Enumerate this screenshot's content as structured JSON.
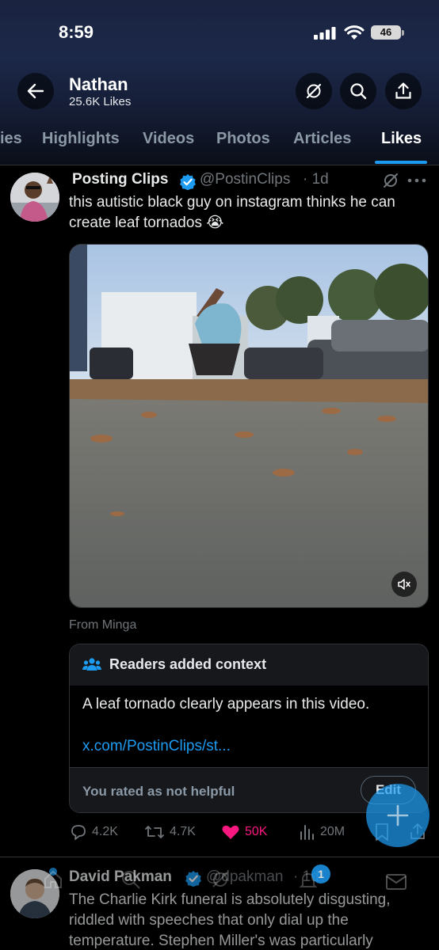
{
  "status_bar": {
    "time": "8:59",
    "battery": "46"
  },
  "profile": {
    "name": "Nathan",
    "likes": "25.6K Likes"
  },
  "tabs": [
    "ies",
    "Highlights",
    "Videos",
    "Photos",
    "Articles",
    "Likes"
  ],
  "active_tab": "Likes",
  "tweet1": {
    "name": "Posting Clips",
    "handle": "@PostinClips",
    "time": "· 1d",
    "text": "this autistic black guy on instagram thinks he can create leaf tornados 😭",
    "source": "From Minga",
    "note": {
      "title": "Readers added context",
      "body": "A leaf tornado clearly appears in this video.",
      "link": "x.com/PostinClips/st...",
      "rated": "You rated as not helpful",
      "edit": "Edit"
    },
    "actions": {
      "replies": "4.2K",
      "reposts": "4.7K",
      "likes": "50K",
      "views": "20M"
    }
  },
  "tweet2": {
    "name": "David Pakman",
    "handle": "@dpakman",
    "time": "· 1d",
    "text": "The Charlie Kirk funeral is absolutely disgusting, riddled with speeches that only dial up the temperature. Stephen Miller's was particularly"
  },
  "notification_badge": "1",
  "colors": {
    "accent": "#1d9bf0",
    "like": "#f91880",
    "background": "#000000"
  },
  "icons": [
    "back-arrow-icon",
    "grok-icon",
    "search-icon",
    "share-icon",
    "verified-icon",
    "more-icon",
    "mute-icon",
    "people-icon",
    "reply-icon",
    "repost-icon",
    "heart-icon",
    "views-icon",
    "bookmark-icon",
    "plus-icon",
    "home-icon",
    "bell-icon",
    "mail-icon"
  ]
}
